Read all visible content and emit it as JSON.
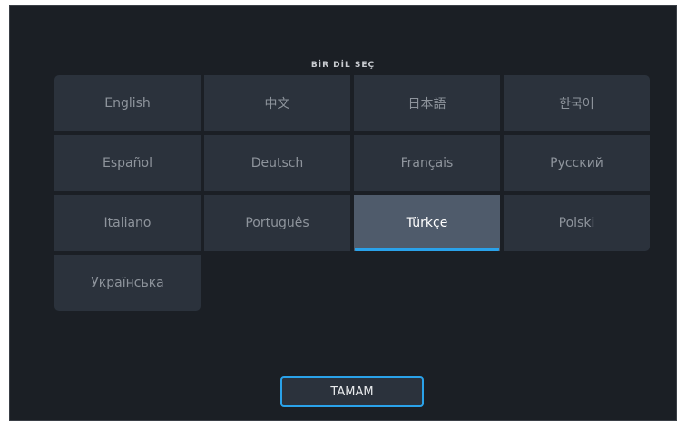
{
  "title": "BİR DİL SEÇ",
  "languages": [
    {
      "label": "English"
    },
    {
      "label": "中文"
    },
    {
      "label": "日本語"
    },
    {
      "label": "한국어"
    },
    {
      "label": "Español"
    },
    {
      "label": "Deutsch"
    },
    {
      "label": "Français"
    },
    {
      "label": "Русский"
    },
    {
      "label": "Italiano"
    },
    {
      "label": "Português"
    },
    {
      "label": "Türkçe"
    },
    {
      "label": "Polski"
    },
    {
      "label": "Українська"
    }
  ],
  "selected_language": "Türkçe",
  "ok_button": {
    "label": "TAMAM"
  },
  "colors": {
    "background": "#1b1f25",
    "button": "#2b323c",
    "selected": "#4f5b6b",
    "accent": "#2aa2ea"
  }
}
